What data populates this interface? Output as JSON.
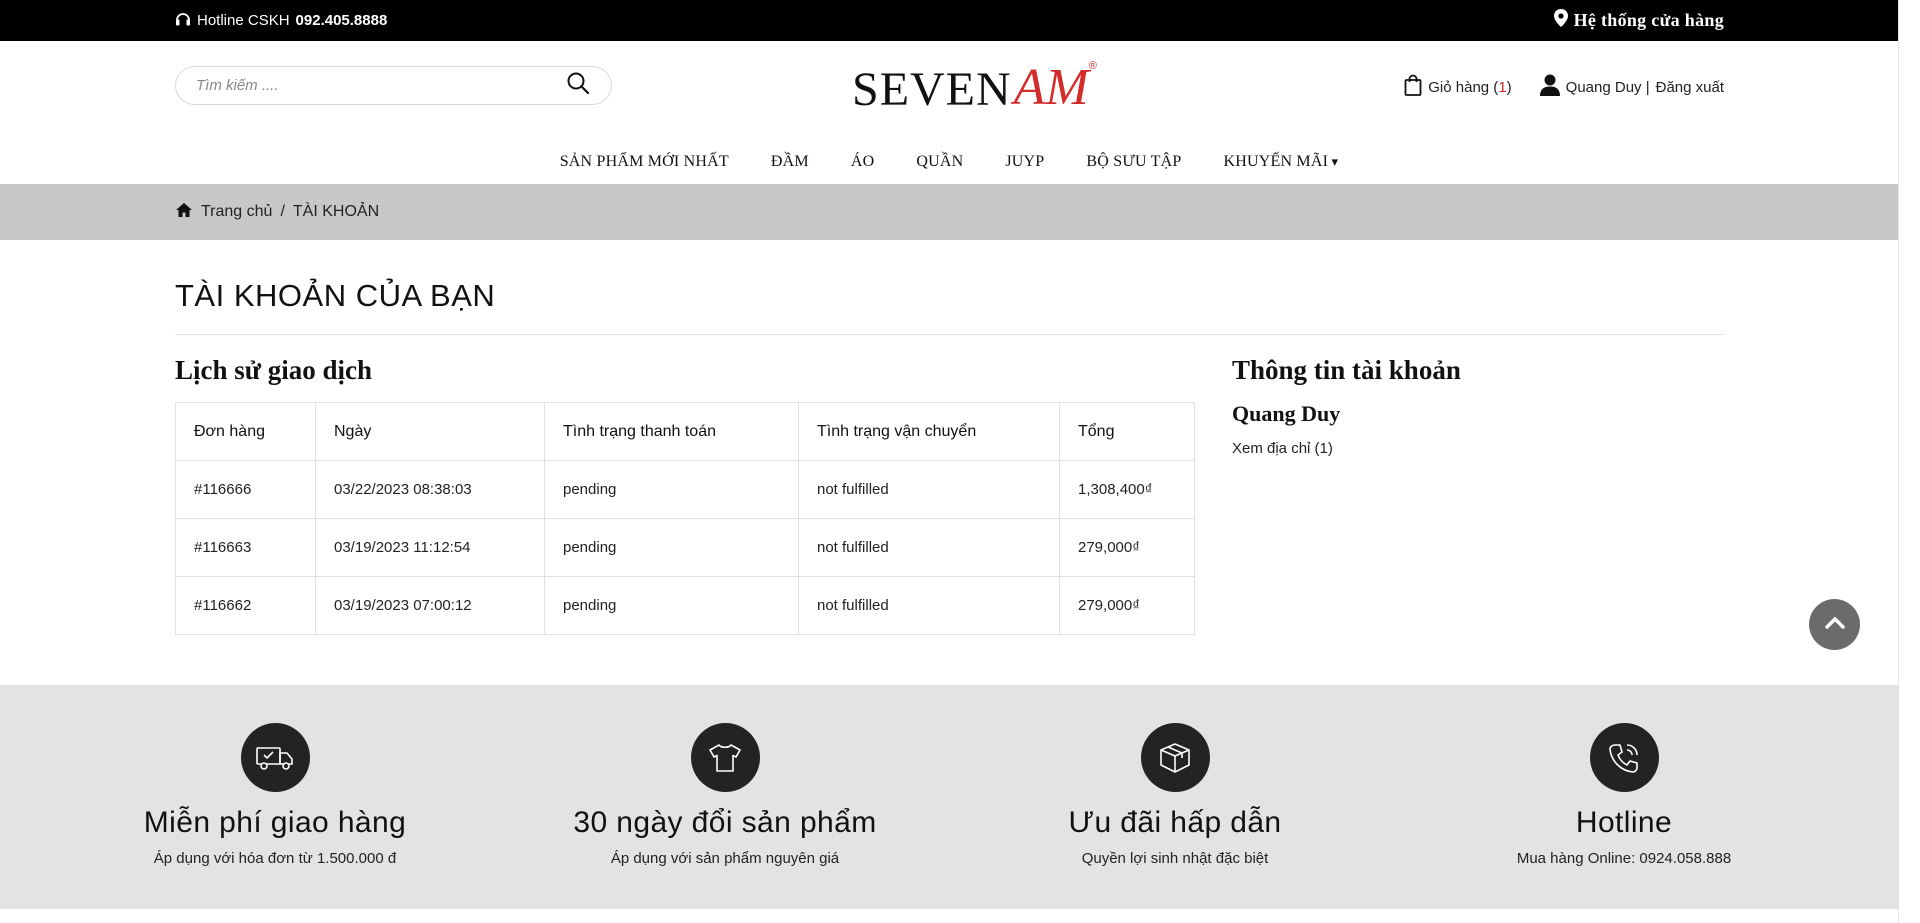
{
  "topbar": {
    "hotline_label": "Hotline CSKH",
    "hotline_number": "092.405.8888",
    "stores_label": "Hệ thống cửa hàng"
  },
  "header": {
    "search_placeholder": "Tìm kiếm ....",
    "logo_seven": "SEVEN",
    "logo_am": "AM",
    "logo_reg": "®",
    "cart_label": "Giỏ hàng (",
    "cart_count": "1",
    "cart_close": ")",
    "user_name": "Quang Duy |",
    "logout_label": "Đăng xuất"
  },
  "menu": {
    "items": [
      {
        "label": "SẢN PHẨM MỚI NHẤT"
      },
      {
        "label": "ĐẦM"
      },
      {
        "label": "ÁO"
      },
      {
        "label": "QUẦN"
      },
      {
        "label": "JUYP"
      },
      {
        "label": "BỘ SƯU TẬP"
      },
      {
        "label": "KHUYẾN MÃI"
      }
    ]
  },
  "breadcrumb": {
    "home": "Trang chủ",
    "separator": "/",
    "current": "TÀI KHOẢN"
  },
  "main": {
    "page_title": "TÀI KHOẢN CỦA BẠN",
    "history_title": "Lịch sử giao dịch",
    "table": {
      "headers": [
        "Đơn hàng",
        "Ngày",
        "Tình trạng thanh toán",
        "Tình trạng vận chuyển",
        "Tổng"
      ],
      "rows": [
        [
          "#116666",
          "03/22/2023 08:38:03",
          "pending",
          "not fulfilled",
          "1,308,400₫"
        ],
        [
          "#116663",
          "03/19/2023 11:12:54",
          "pending",
          "not fulfilled",
          "279,000₫"
        ],
        [
          "#116662",
          "03/19/2023 07:00:12",
          "pending",
          "not fulfilled",
          "279,000₫"
        ]
      ]
    },
    "account_title": "Thông tin tài khoản",
    "account_name": "Quang Duy",
    "address_link": "Xem địa chỉ (1)"
  },
  "features": [
    {
      "icon": "delivery-truck-icon",
      "title": "Miễn phí giao hàng",
      "subtitle": "Áp dụng với hóa đơn từ 1.500.000 đ"
    },
    {
      "icon": "tshirt-icon",
      "title": "30 ngày đổi sản phẩm",
      "subtitle": "Áp dụng với sản phẩm nguyên giá"
    },
    {
      "icon": "gift-box-icon",
      "title": "Ưu đãi hấp dẫn",
      "subtitle": "Quyền lợi sinh nhật đặc biệt"
    },
    {
      "icon": "phone-icon",
      "title": "Hotline",
      "subtitle": "Mua hàng Online: 0924.058.888"
    }
  ],
  "colors": {
    "topbar_bg": "#000000",
    "accent_red": "#d42b2b",
    "breadcrumb_bg": "#c8c8c8",
    "features_bg": "#e3e3e3",
    "feature_circle": "#232323",
    "back_to_top": "#6b6b6b"
  }
}
